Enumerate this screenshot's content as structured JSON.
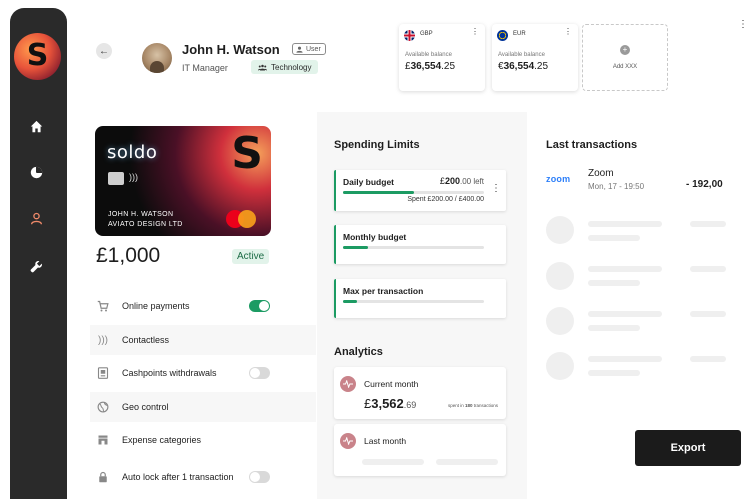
{
  "brand": {
    "logo_letter": "S"
  },
  "header": {
    "user_name": "John H. Watson",
    "user_badge": "User",
    "user_role": "IT Manager",
    "team": "Technology"
  },
  "balances": [
    {
      "currency": "GBP",
      "label": "Available balance",
      "amount_symbol": "£",
      "amount_int": "36,554",
      "amount_dec": ".25",
      "flag": "uk-flag-icon"
    },
    {
      "currency": "EUR",
      "label": "Available balance",
      "amount_symbol": "€",
      "amount_int": "36,554",
      "amount_dec": ".25",
      "flag": "eu-flag-icon"
    }
  ],
  "add_card": {
    "label": "Add XXX"
  },
  "card": {
    "brand_text": "soldo",
    "logo_letter": "S",
    "holder_line1": "JOHN H. WATSON",
    "holder_line2": "AVIATO DESIGN LTD",
    "limit": "£1,000",
    "status": "Active"
  },
  "settings": [
    {
      "label": "Online payments",
      "toggle": "on",
      "icon": "cart-icon"
    },
    {
      "label": "Contactless",
      "toggle": null,
      "icon": "contactless-icon"
    },
    {
      "label": "Cashpoints withdrawals",
      "toggle": "off",
      "icon": "atm-icon"
    },
    {
      "label": "Geo control",
      "toggle": null,
      "icon": "globe-icon"
    },
    {
      "label": "Expense categories",
      "toggle": null,
      "icon": "store-icon"
    },
    {
      "label": "Auto lock after 1 transaction",
      "toggle": "off",
      "icon": "lock-icon"
    }
  ],
  "spending": {
    "title": "Spending Limits",
    "daily": {
      "name": "Daily budget",
      "left_symbol": "£",
      "left_int": "200",
      "left_dec": ".00",
      "left_suffix": " left",
      "spent": "Spent £200.00 / £400.00",
      "progress": 0.5
    },
    "monthly": {
      "name": "Monthly budget",
      "progress": 0.18
    },
    "per_tx": {
      "name": "Max per transaction",
      "progress": 0.1
    }
  },
  "analytics": {
    "title": "Analytics",
    "current": {
      "name": "Current month",
      "symbol": "£",
      "int": "3,562",
      "dec": ".69",
      "note_pre": "spent in ",
      "note_count": "180",
      "note_post": " transactions"
    },
    "last": {
      "name": "Last month"
    }
  },
  "transactions": {
    "title": "Last transactions",
    "items": [
      {
        "logo": "zoom",
        "name": "Zoom",
        "date": "Mon, 17 - 19:50",
        "amount": "- 192,00"
      }
    ]
  },
  "export_label": "Export",
  "colors": {
    "accent": "#1c9b63",
    "dark": "#1b1b1b",
    "sidebar": "#2a2a2a",
    "analytics_dot": "#c9838a"
  }
}
